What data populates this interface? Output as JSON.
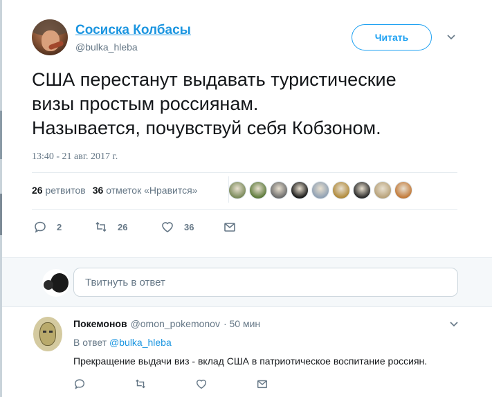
{
  "tweet": {
    "author_name": "Сосиска Колбасы",
    "author_handle": "@bulka_hleba",
    "follow_label": "Читать",
    "text": "США перестанут выдавать туристические\nвизы простым россиянам.\nНазывается, почувствуй себя Кобзоном.",
    "timestamp": "13:40 - 21 авг. 2017 г.",
    "retweets_count": "26",
    "retweets_label": "ретвитов",
    "likes_count": "36",
    "likes_label": "отметок «Нравится»",
    "actions": {
      "reply_count": "2",
      "retweet_count": "26",
      "like_count": "36"
    },
    "likers": [
      "#7a8a5a",
      "#5d7a3b",
      "#6b6b6b",
      "#1a1a1a",
      "#8fa0b3",
      "#b08a3c",
      "#2a2a2a",
      "#b8a27a",
      "#c27a3a"
    ]
  },
  "reply_box": {
    "placeholder": "Твитнуть в ответ"
  },
  "reply": {
    "author_name": "Покемонов",
    "author_handle": "@omon_pokemonov",
    "time": "· 50 мин",
    "reply_to_prefix": "В ответ",
    "reply_to_handle": "@bulka_hleba",
    "text": "Прекращение выдачи виз - вклад США в патриотическое воспитание россиян."
  }
}
